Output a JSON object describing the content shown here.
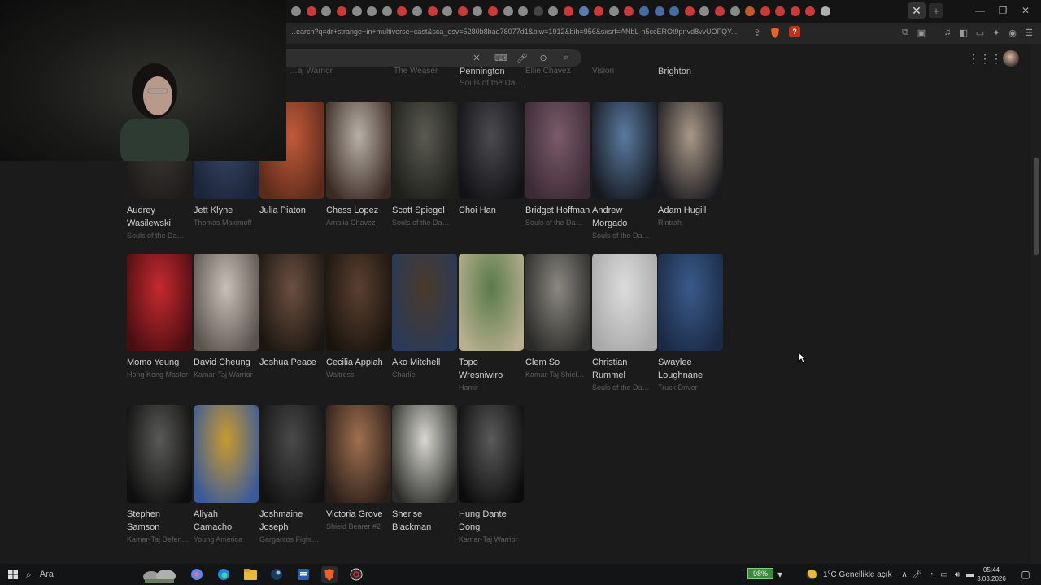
{
  "browser": {
    "url": "…earch?q=dr+strange+in+multiverse+cast&sca_esv=5280b8bad78077d1&biw=1912&bih=956&sxsrf=ANbL-n5ccEROt9pnvd8vvUOFQY...",
    "tab_close_glyph": "✕",
    "new_tab_glyph": "+",
    "extension_badge": "?",
    "tab_colors": [
      "#8a8a8a",
      "#c73b3b",
      "#8a8a8a",
      "#c73b3b",
      "#8a8a8a",
      "#8a8a8a",
      "#8a8a8a",
      "#c73b3b",
      "#8a8a8a",
      "#c73b3b",
      "#8a8a8a",
      "#c73b3b",
      "#8a8a8a",
      "#c73b3b",
      "#8a8a8a",
      "#8a8a8a",
      "#444444",
      "#8a8a8a",
      "#c73b3b",
      "#5a7ab0",
      "#c73b3b",
      "#8a8a8a",
      "#c73b3b",
      "#4a6aa0",
      "#4a6aa0",
      "#4a6aa0",
      "#c73b3b",
      "#8a8a8a",
      "#c73b3b",
      "#8a8a8a",
      "#c05a2a",
      "#c73b3b",
      "#c73b3b",
      "#c73b3b",
      "#c73b3b",
      "#b0b0b0"
    ]
  },
  "previous_row": [
    {
      "text": "…aj Warrior",
      "style": "dim"
    },
    {
      "text": "The Weaser",
      "style": "dim"
    },
    {
      "text": "Pennington",
      "style": "bright"
    },
    {
      "text": "Souls of the Da…",
      "style": "dim"
    },
    {
      "text": "Ellie Chavez",
      "style": "dim"
    },
    {
      "text": "Vision",
      "style": "dim"
    },
    {
      "text": "Brighton",
      "style": "bright"
    }
  ],
  "cast": [
    {
      "name": "Audrey Wasilewski",
      "role": "Souls of the Da…",
      "colors": [
        "#3d3a36",
        "#1e1c1a"
      ]
    },
    {
      "name": "Jett Klyne",
      "role": "Thomas Maximoff",
      "colors": [
        "#3a4a6a",
        "#1b2438"
      ]
    },
    {
      "name": "Julia Piaton",
      "role": "",
      "colors": [
        "#c25a3a",
        "#5a2a1a"
      ]
    },
    {
      "name": "Chess Lopez",
      "role": "Amalia Chavez",
      "colors": [
        "#b8b0a8",
        "#3a2a22"
      ]
    },
    {
      "name": "Scott Spiegel",
      "role": "Souls of the Da…",
      "colors": [
        "#5a5a52",
        "#1e1e1a"
      ]
    },
    {
      "name": "Choi Han",
      "role": "",
      "colors": [
        "#4a4a50",
        "#121214"
      ]
    },
    {
      "name": "Bridget Hoffman",
      "role": "Souls of the Da…",
      "colors": [
        "#7a5a6a",
        "#3a2a34"
      ]
    },
    {
      "name": "Andrew Morgado",
      "role": "Souls of the Da…",
      "colors": [
        "#5a7aa0",
        "#15181e"
      ]
    },
    {
      "name": "Adam Hugill",
      "role": "Rintrah",
      "colors": [
        "#a89888",
        "#1a1a1e"
      ]
    },
    {
      "name": "Momo Yeung",
      "role": "Hong Kong Master",
      "colors": [
        "#c62a30",
        "#4a0e12"
      ]
    },
    {
      "name": "David Cheung",
      "role": "Kamar-Taj Warrior",
      "colors": [
        "#c8c0b8",
        "#5a524c"
      ]
    },
    {
      "name": "Joshua Peace",
      "role": "",
      "colors": [
        "#6a5040",
        "#1c1612"
      ]
    },
    {
      "name": "Cecilia Appiah",
      "role": "Waitress",
      "colors": [
        "#5a4030",
        "#1a140e"
      ]
    },
    {
      "name": "Ako Mitchell",
      "role": "Charlie",
      "colors": [
        "#4a3a2a",
        "#2a3a5a"
      ]
    },
    {
      "name": "Topo Wresniwiro",
      "role": "Hamir",
      "colors": [
        "#5a7a4a",
        "#b8b090"
      ]
    },
    {
      "name": "Clem So",
      "role": "Kamar-Taj Shiel…",
      "colors": [
        "#8a8880",
        "#2a2a28"
      ]
    },
    {
      "name": "Christian Rummel",
      "role": "Souls of the Da…",
      "colors": [
        "#dcdcdc",
        "#a8a8a8"
      ]
    },
    {
      "name": "Swaylee Loughnane",
      "role": "Truck Driver",
      "colors": [
        "#3a5a8a",
        "#1a2a44"
      ]
    },
    {
      "name": "Stephen Samson",
      "role": "Kamar-Taj Defen…",
      "colors": [
        "#5a5a58",
        "#0e0e0e"
      ]
    },
    {
      "name": "Aliyah Camacho",
      "role": "Young America",
      "colors": [
        "#c89a30",
        "#3a5a9a"
      ]
    },
    {
      "name": "Joshmaine Joseph",
      "role": "Gargantos Fight…",
      "colors": [
        "#4a4a4a",
        "#121212"
      ]
    },
    {
      "name": "Victoria Grove",
      "role": "Shield Bearer #2",
      "colors": [
        "#a07050",
        "#2a1e18"
      ]
    },
    {
      "name": "Sherise Blackman",
      "role": "",
      "colors": [
        "#d8d8d0",
        "#2a2a28"
      ]
    },
    {
      "name": "Hung Dante Dong",
      "role": "Kamar-Taj Warrior",
      "colors": [
        "#5a5a5a",
        "#0c0c0c"
      ]
    }
  ],
  "taskbar": {
    "search_label": "Ara",
    "battery": "98%",
    "weather": "1°C  Genellikle açık",
    "time": "05:44",
    "date": "3.03.2026"
  }
}
